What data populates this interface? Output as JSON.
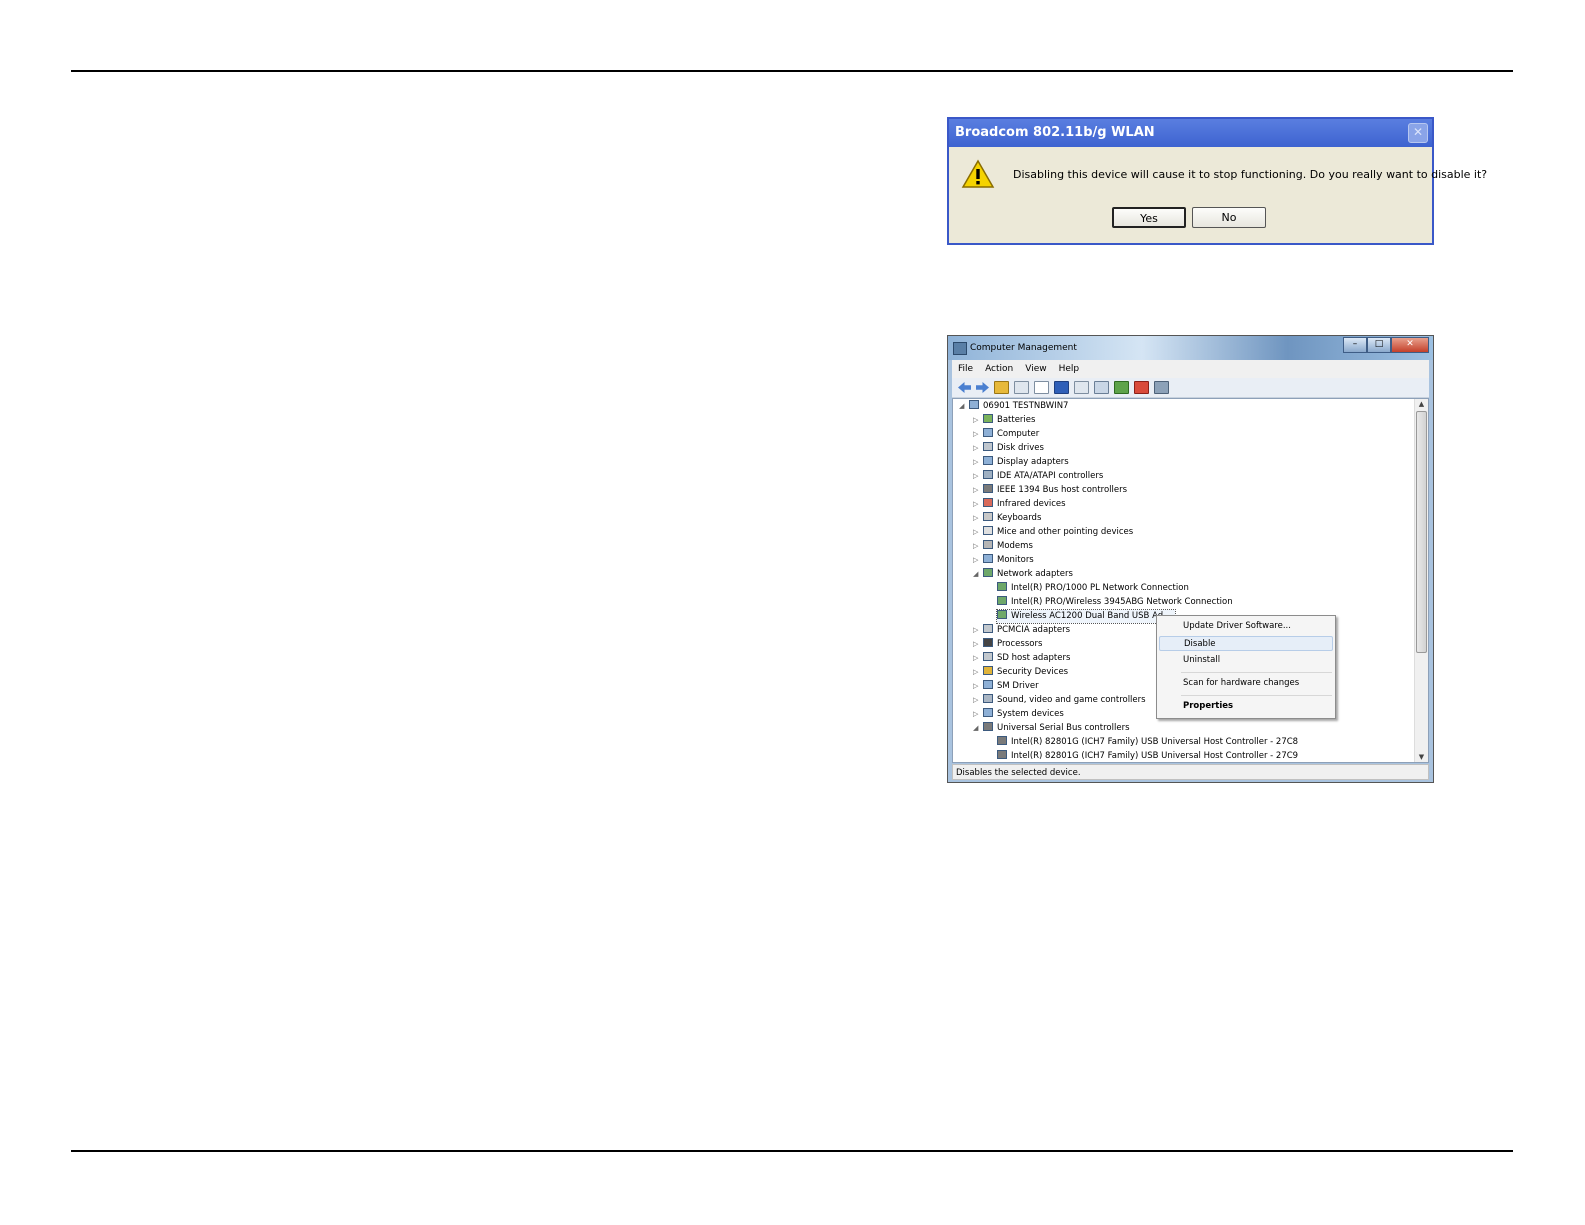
{
  "dialog": {
    "title": "Broadcom 802.11b/g WLAN",
    "close_label": "✕",
    "message": "Disabling this device will cause it to stop functioning. Do you really want to disable it?",
    "yes_label": "Yes",
    "no_label": "No"
  },
  "window": {
    "title": "Computer Management",
    "minimize": "–",
    "maximize": "□",
    "close": "✕",
    "menu": [
      "File",
      "Action",
      "View",
      "Help"
    ],
    "status": "Disables the selected device."
  },
  "tree": [
    {
      "label": "06901 TESTNBWIN7",
      "expanded": "◢"
    },
    {
      "label": "Batteries",
      "expanded": "▷"
    },
    {
      "label": "Computer",
      "expanded": "▷"
    },
    {
      "label": "Disk drives",
      "expanded": "▷"
    },
    {
      "label": "Display adapters",
      "expanded": "▷"
    },
    {
      "label": "IDE ATA/ATAPI controllers",
      "expanded": "▷"
    },
    {
      "label": "IEEE 1394 Bus host controllers",
      "expanded": "▷"
    },
    {
      "label": "Infrared devices",
      "expanded": "▷"
    },
    {
      "label": "Keyboards",
      "expanded": "▷"
    },
    {
      "label": "Mice and other pointing devices",
      "expanded": "▷"
    },
    {
      "label": "Modems",
      "expanded": "▷"
    },
    {
      "label": "Monitors",
      "expanded": "▷"
    },
    {
      "label": "Network adapters",
      "expanded": "◢"
    },
    {
      "label": "Intel(R) PRO/1000 PL Network Connection",
      "expanded": ""
    },
    {
      "label": "Intel(R) PRO/Wireless 3945ABG Network Connection",
      "expanded": ""
    },
    {
      "label": "Wireless AC1200 Dual Band USB Ad...",
      "expanded": ""
    },
    {
      "label": "PCMCIA adapters",
      "expanded": "▷"
    },
    {
      "label": "Processors",
      "expanded": "▷"
    },
    {
      "label": "SD host adapters",
      "expanded": "▷"
    },
    {
      "label": "Security Devices",
      "expanded": "▷"
    },
    {
      "label": "SM Driver",
      "expanded": "▷"
    },
    {
      "label": "Sound, video and game controllers",
      "expanded": "▷"
    },
    {
      "label": "System devices",
      "expanded": "▷"
    },
    {
      "label": "Universal Serial Bus controllers",
      "expanded": "◢"
    },
    {
      "label": "Intel(R) 82801G (ICH7 Family) USB Universal Host Controller - 27C8",
      "expanded": ""
    },
    {
      "label": "Intel(R) 82801G (ICH7 Family) USB Universal Host Controller - 27C9",
      "expanded": ""
    }
  ],
  "context_menu": {
    "update": "Update Driver Software...",
    "disable": "Disable",
    "uninstall": "Uninstall",
    "scan": "Scan for hardware changes",
    "properties": "Properties"
  },
  "colors": {
    "dialog_title_bar": "#3d63d0",
    "dialog_background": "#ece9d8",
    "warning_yellow": "#f5d300"
  }
}
